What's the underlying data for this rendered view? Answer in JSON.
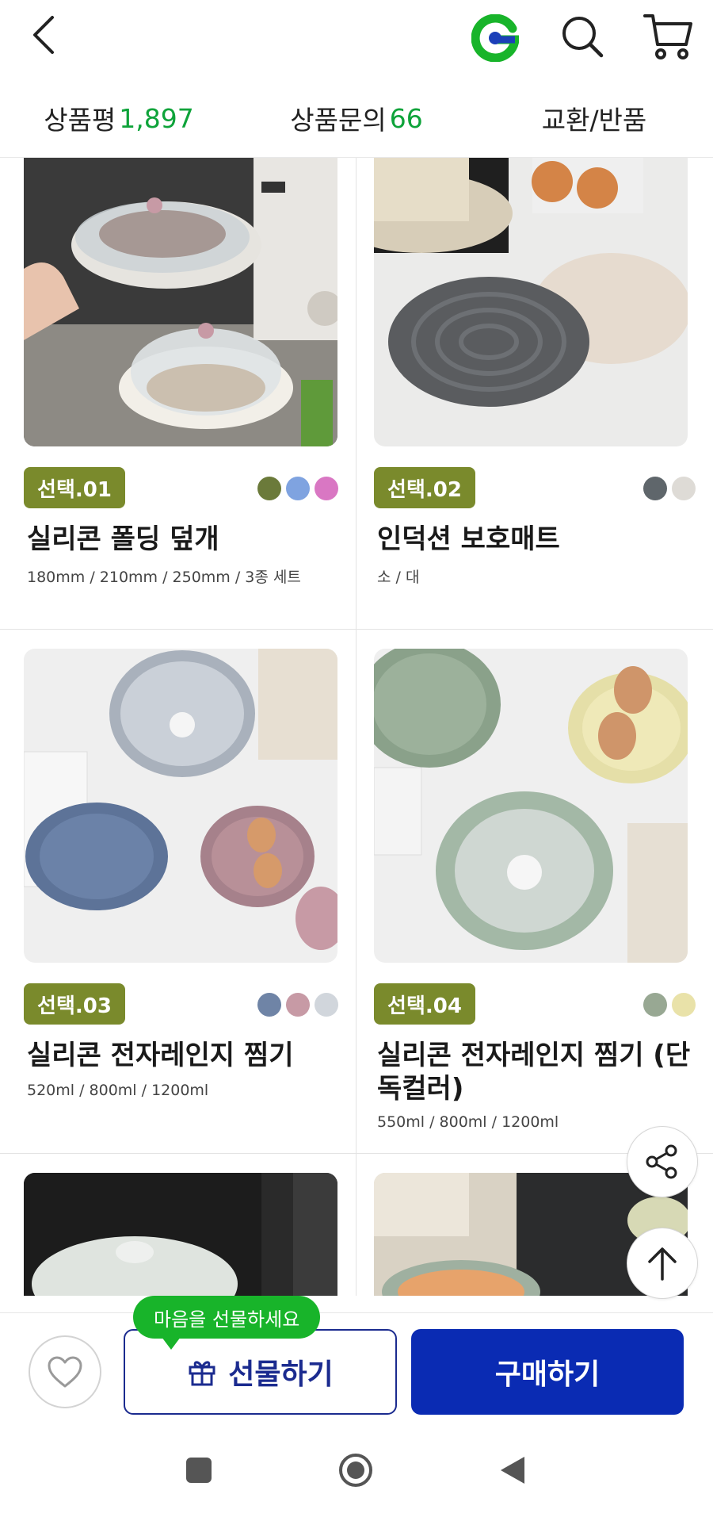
{
  "topbar": {
    "icons": [
      "back-icon",
      "g-logo",
      "search-icon",
      "cart-icon"
    ],
    "colors": {
      "logo_green": "#18b42a",
      "logo_blue": "#1b3fb8"
    }
  },
  "tabs": [
    {
      "label": "상품평",
      "count": "1,897"
    },
    {
      "label": "상품문의",
      "count": "66"
    },
    {
      "label": "교환/반품",
      "count": ""
    }
  ],
  "products": [
    {
      "badge": "선택.01",
      "name": "실리콘 폴딩 덮개",
      "options": "180mm / 210mm / 250mm / 3종 세트",
      "swatches": [
        "#6b7a3a",
        "#7fa3e0",
        "#d977c3"
      ]
    },
    {
      "badge": "선택.02",
      "name": "인덕션 보호매트",
      "options": "소 / 대",
      "swatches": [
        "#5f666b",
        "#dedbd6"
      ]
    },
    {
      "badge": "선택.03",
      "name": "실리콘 전자레인지 찜기",
      "options": "520ml / 800ml / 1200ml",
      "swatches": [
        "#6f84a6",
        "#c79aa5",
        "#d1d6dc"
      ]
    },
    {
      "badge": "선택.04",
      "name": "실리콘 전자레인지 찜기 (단독컬러)",
      "options": "550ml / 800ml / 1200ml",
      "swatches": [
        "#98a893",
        "#e9e2a9"
      ]
    }
  ],
  "badge_color": "#7a8a2c",
  "bottom": {
    "gift_tip": "마음을 선물하세요",
    "gift_label": "선물하기",
    "buy_label": "구매하기",
    "buy_color": "#0a2bb3",
    "gift_color": "#1b2b8f"
  },
  "floating": [
    "share-icon",
    "scroll-top-icon"
  ],
  "navbar": [
    "recent-apps-icon",
    "home-icon",
    "back-nav-icon"
  ]
}
